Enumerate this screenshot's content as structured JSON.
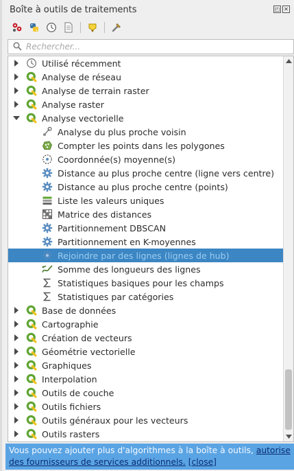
{
  "window": {
    "title": "Boîte à outils de traitements",
    "float_btn": "◰",
    "close_btn": "✕"
  },
  "toolbar": {
    "icons": [
      "models-icon",
      "python-icon",
      "history-icon",
      "results-icon",
      "edit-rendering-styles-icon",
      "options-icon"
    ]
  },
  "search": {
    "placeholder": "Rechercher..."
  },
  "tree": {
    "providers_before": [
      {
        "label": "Utilisé récemment",
        "icon": "clock-icon"
      },
      {
        "label": "Analyse de réseau",
        "icon": "qgis-icon"
      },
      {
        "label": "Analyse de terrain raster",
        "icon": "qgis-icon"
      },
      {
        "label": "Analyse raster",
        "icon": "qgis-icon"
      }
    ],
    "expanded": {
      "label": "Analyse vectorielle",
      "icon": "qgis-icon"
    },
    "algorithms": [
      {
        "label": "Analyse du plus proche voisin",
        "icon": "nearest-neighbour-icon"
      },
      {
        "label": "Compter les points dans les polygones",
        "icon": "count-points-icon"
      },
      {
        "label": "Coordonnée(s) moyenne(s)",
        "icon": "mean-coordinates-icon"
      },
      {
        "label": "Distance au plus proche centre (ligne vers centre)",
        "icon": "gear-icon"
      },
      {
        "label": "Distance au plus proche centre (points)",
        "icon": "gear-icon"
      },
      {
        "label": "Liste les valeurs uniques",
        "icon": "unique-values-icon"
      },
      {
        "label": "Matrice des distances",
        "icon": "distance-matrix-icon"
      },
      {
        "label": "Partitionnement DBSCAN",
        "icon": "gear-icon"
      },
      {
        "label": "Partitionnement en K-moyennes",
        "icon": "gear-icon"
      },
      {
        "label": "Rejoindre par des lignes (lignes de hub)",
        "icon": "gear-icon",
        "selected": true
      },
      {
        "label": "Somme des longueurs des lignes",
        "icon": "sum-lengths-icon"
      },
      {
        "label": "Statistiques basiques pour les champs",
        "icon": "sigma-icon"
      },
      {
        "label": "Statistiques par catégories",
        "icon": "sigma-icon"
      }
    ],
    "providers_after": [
      {
        "label": "Base de données",
        "icon": "qgis-icon"
      },
      {
        "label": "Cartographie",
        "icon": "qgis-icon"
      },
      {
        "label": "Création de vecteurs",
        "icon": "qgis-icon"
      },
      {
        "label": "Géométrie vectorielle",
        "icon": "qgis-icon"
      },
      {
        "label": "Graphiques",
        "icon": "qgis-icon"
      },
      {
        "label": "Interpolation",
        "icon": "qgis-icon"
      },
      {
        "label": "Outils de couche",
        "icon": "qgis-icon"
      },
      {
        "label": "Outils fichiers",
        "icon": "qgis-icon"
      },
      {
        "label": "Outils généraux pour les vecteurs",
        "icon": "qgis-icon"
      },
      {
        "label": "Outils rasters",
        "icon": "qgis-icon"
      }
    ]
  },
  "notice": {
    "text": "Vous pouvez ajouter plus d'algorithmes à la boîte à outils, ",
    "link_text": "autorise des fournisseurs de services additionnels.",
    "close_text": "[close]"
  },
  "colors": {
    "selection": "#3c86c3",
    "notice_bg": "#5aa4e4",
    "qgis_green": "#5fa532",
    "qgis_yellow": "#f0c21e"
  }
}
